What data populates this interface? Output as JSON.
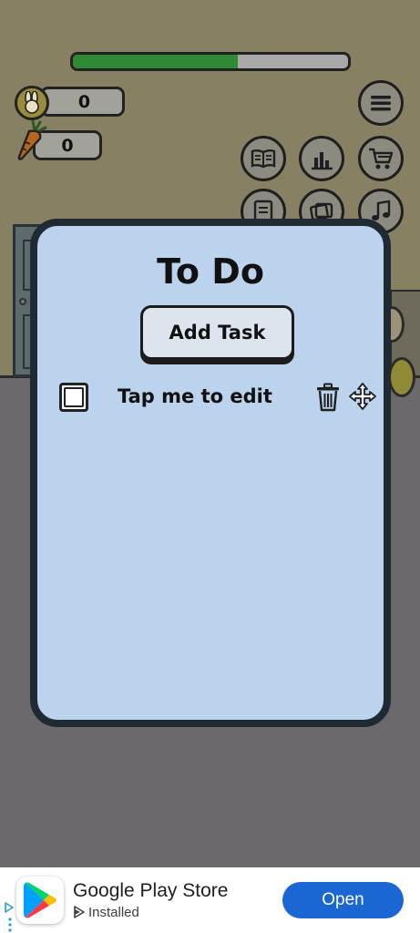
{
  "hud": {
    "progress_fraction": 0.6,
    "progress_color": "#2e8a34",
    "coins": "0",
    "carrots": "0",
    "coin_icon": "bunny-coin-icon",
    "carrot_icon": "carrot-icon"
  },
  "menu_buttons": [
    {
      "name": "menu-icon"
    },
    {
      "name": "journal-icon"
    },
    {
      "name": "stats-icon"
    },
    {
      "name": "shop-cart-icon"
    },
    {
      "name": "checklist-icon"
    },
    {
      "name": "cards-icon"
    },
    {
      "name": "music-note-icon"
    }
  ],
  "todo": {
    "title": "To Do",
    "add_task_label": "Add Task",
    "tasks": [
      {
        "text": "Tap me to edit",
        "done": false
      }
    ]
  },
  "ad": {
    "app_name": "Google Play Store",
    "status": "Installed",
    "cta_label": "Open",
    "cta_color": "#1a66d2"
  },
  "colors": {
    "modal_bg": "#bcd3ed",
    "modal_border": "#202a33",
    "wall": "#878063",
    "floor": "#6b696c"
  }
}
